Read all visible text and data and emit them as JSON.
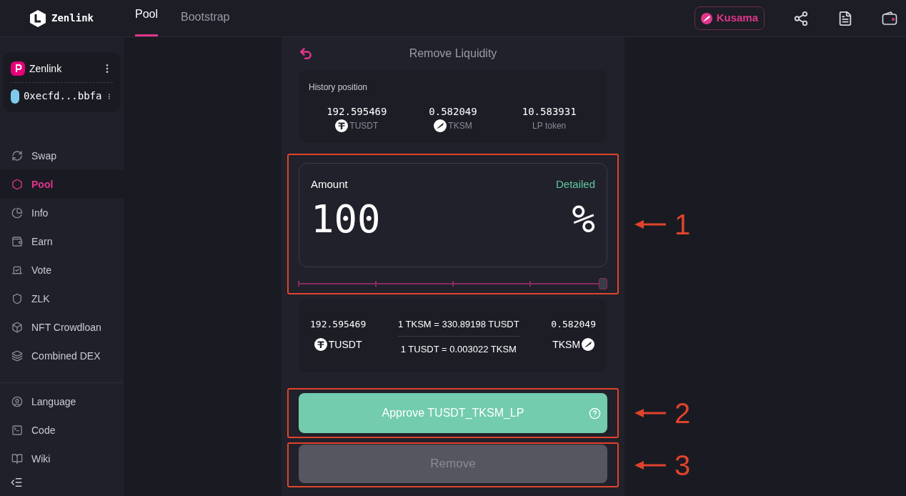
{
  "brand": {
    "name": "Zenlink"
  },
  "top_tabs": [
    {
      "label": "Pool",
      "selected": true
    },
    {
      "label": "Bootstrap",
      "selected": false
    }
  ],
  "network": {
    "label": "Kusama"
  },
  "accounts": [
    {
      "kind": "chain",
      "label": "Zenlink"
    },
    {
      "kind": "wallet",
      "label": "0xecfd...bbfa"
    }
  ],
  "nav": [
    {
      "label": "Swap",
      "selected": false
    },
    {
      "label": "Pool",
      "selected": true
    },
    {
      "label": "Info",
      "selected": false
    },
    {
      "label": "Earn",
      "selected": false
    },
    {
      "label": "Vote",
      "selected": false
    },
    {
      "label": "ZLK",
      "selected": false
    },
    {
      "label": "NFT Crowdloan",
      "selected": false
    },
    {
      "label": "Combined DEX",
      "selected": false
    }
  ],
  "nav_footer": [
    {
      "label": "Language"
    },
    {
      "label": "Code"
    },
    {
      "label": "Wiki"
    }
  ],
  "panel": {
    "title": "Remove Liquidity",
    "history": {
      "title": "History position",
      "items": [
        {
          "kind": "tusdt",
          "value": "192.595469",
          "token": "TUSDT"
        },
        {
          "kind": "tksm",
          "value": "0.582049",
          "token": "TKSM"
        },
        {
          "kind": "lp",
          "value": "10.583931",
          "token": "LP token"
        }
      ]
    },
    "amount": {
      "label": "Amount",
      "mode": "Detailed",
      "value": "100",
      "unit": "%",
      "level": 1
    },
    "receive": [
      {
        "value": "192.595469",
        "token": "TUSDT"
      },
      {
        "value": "0.582049",
        "token": "TKSM"
      }
    ],
    "rates": [
      "1 TKSM = 330.89198 TUSDT",
      "1 TUSDT = 0.003022 TKSM"
    ],
    "approve": {
      "label": "Approve TUSDT_TKSM_LP",
      "disabled": false
    },
    "remove": {
      "label": "Remove",
      "disabled": true
    }
  },
  "callouts": [
    "1",
    "2",
    "3"
  ]
}
